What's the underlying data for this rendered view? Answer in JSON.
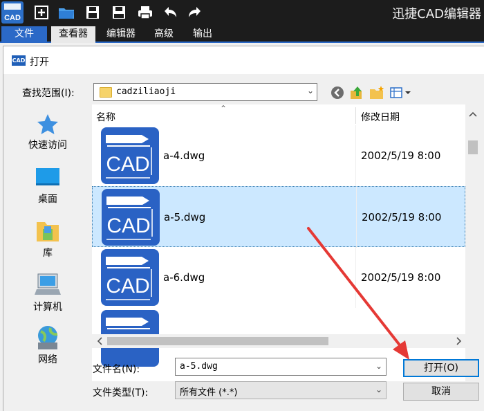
{
  "app": {
    "title": "迅捷CAD编辑器",
    "logo_text": "CAD",
    "toolbar_icons": [
      "app-logo-icon",
      "new-icon",
      "open-folder-icon",
      "save-icon",
      "save-pdf-icon",
      "print-icon",
      "undo-icon",
      "redo-icon"
    ],
    "menu": {
      "file": "文件",
      "tabs": [
        "查看器",
        "编辑器",
        "高级",
        "输出"
      ],
      "active_tab": "查看器"
    }
  },
  "dialog": {
    "title": "打开",
    "icon_text": "CAD",
    "look_in_label": "查找范围(I):",
    "look_in_value": "cadziliaoji",
    "places": [
      "快速访问",
      "桌面",
      "库",
      "计算机",
      "网络"
    ],
    "columns": {
      "name": "名称",
      "date": "修改日期"
    },
    "files": [
      {
        "name": "a-4.dwg",
        "date": "2002/5/19 8:00",
        "selected": false
      },
      {
        "name": "a-5.dwg",
        "date": "2002/5/19 8:00",
        "selected": true
      },
      {
        "name": "a-6.dwg",
        "date": "2002/5/19 8:00",
        "selected": false
      }
    ],
    "thumb_text": "CAD",
    "filename_label": "文件名(N):",
    "filename_value": "a-5.dwg",
    "filetype_label": "文件类型(T):",
    "filetype_value": "所有文件 (*.*)",
    "open_button": "打开(O)",
    "cancel_button": "取消"
  },
  "colors": {
    "accent": "#2b69c7",
    "selection": "#cce8ff",
    "thumb_blue": "#2a62c4",
    "annotation_arrow": "#e53935"
  }
}
